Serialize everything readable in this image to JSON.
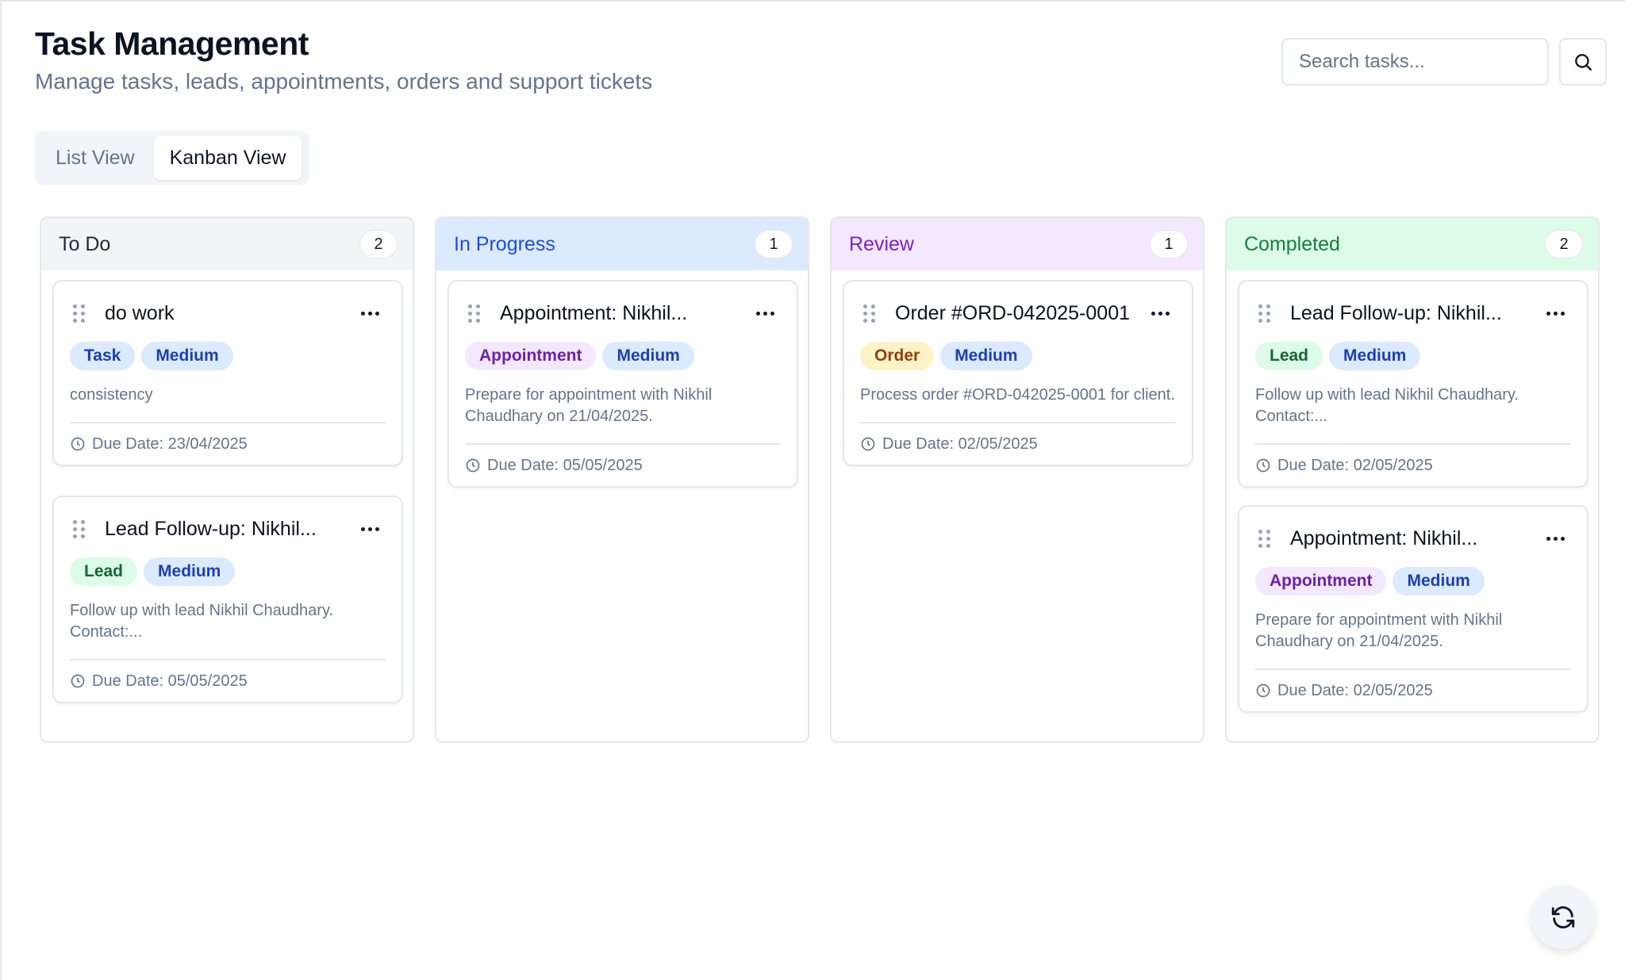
{
  "header": {
    "title": "Task Management",
    "subtitle": "Manage tasks, leads, appointments, orders and support tickets"
  },
  "search": {
    "placeholder": "Search tasks..."
  },
  "views": {
    "list": "List View",
    "kanban": "Kanban View",
    "active": "Kanban View"
  },
  "columns": [
    {
      "title": "To Do",
      "count": "2",
      "head_bg": "#f3f4f6",
      "title_color": "#1f2937",
      "cards": [
        {
          "title": "do work",
          "type": "Task",
          "priority": "Medium",
          "desc": "consistency",
          "due": "Due Date: 23/04/2025"
        },
        {
          "title": "Lead Follow-up: Nikhil...",
          "type": "Lead",
          "priority": "Medium",
          "desc": "Follow up with lead Nikhil Chaudhary. Contact:...",
          "due": "Due Date: 05/05/2025"
        }
      ]
    },
    {
      "title": "In Progress",
      "count": "1",
      "head_bg": "#dbeafe",
      "title_color": "#1d4ed8",
      "cards": [
        {
          "title": "Appointment: Nikhil...",
          "type": "Appointment",
          "priority": "Medium",
          "desc": "Prepare for appointment with Nikhil Chaudhary on 21/04/2025.",
          "due": "Due Date: 05/05/2025"
        }
      ]
    },
    {
      "title": "Review",
      "count": "1",
      "head_bg": "#f3e8ff",
      "title_color": "#7e22ce",
      "cards": [
        {
          "title": "Order #ORD-042025-0001",
          "type": "Order",
          "priority": "Medium",
          "desc": "Process order #ORD-042025-0001 for client.",
          "due": "Due Date: 02/05/2025"
        }
      ]
    },
    {
      "title": "Completed",
      "count": "2",
      "head_bg": "#dcfce7",
      "title_color": "#15803d",
      "cards": [
        {
          "title": "Lead Follow-up: Nikhil...",
          "type": "Lead",
          "priority": "Medium",
          "desc": "Follow up with lead Nikhil Chaudhary. Contact:...",
          "due": "Due Date: 02/05/2025"
        },
        {
          "title": "Appointment: Nikhil...",
          "type": "Appointment",
          "priority": "Medium",
          "desc": "Prepare for appointment with Nikhil Chaudhary on 21/04/2025.",
          "due": "Due Date: 02/05/2025"
        }
      ]
    }
  ],
  "tag_colors": {
    "Task": {
      "bg": "#dbeafe",
      "fg": "#1e40af"
    },
    "Lead": {
      "bg": "#dcfce7",
      "fg": "#166534"
    },
    "Appointment": {
      "bg": "#f3e8ff",
      "fg": "#6b21a8"
    },
    "Order": {
      "bg": "#fef3c7",
      "fg": "#92400e"
    },
    "Medium": {
      "bg": "#dbeafe",
      "fg": "#1e40af"
    }
  },
  "icons": {
    "search": "search-icon",
    "refresh": "refresh-icon",
    "clock": "clock-icon",
    "drag": "drag-handle-icon",
    "more": "more-horizontal-icon"
  }
}
